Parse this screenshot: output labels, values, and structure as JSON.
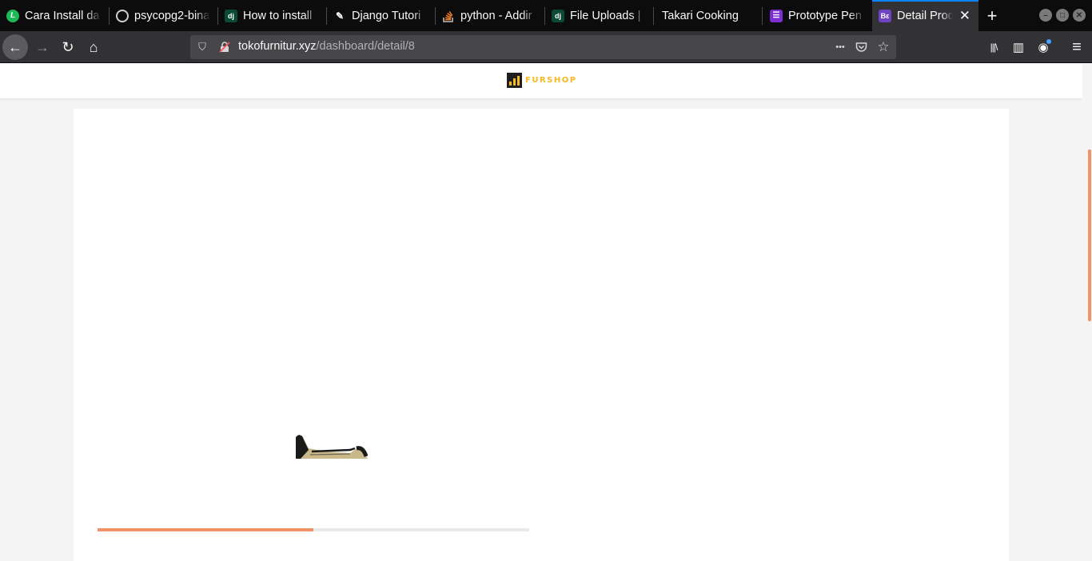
{
  "browser": {
    "tabs": [
      {
        "title": "Cara Install da",
        "favicon": "letter-l-icon",
        "active": false
      },
      {
        "title": "psycopg2-bina",
        "favicon": "github-icon",
        "active": false
      },
      {
        "title": "How to install",
        "favicon": "django-icon",
        "active": false
      },
      {
        "title": "Django Tutori",
        "favicon": "wagtail-icon",
        "active": false
      },
      {
        "title": "python - Addir",
        "favicon": "stackoverflow-icon",
        "active": false
      },
      {
        "title": "File Uploads |",
        "favicon": "django-icon",
        "active": false
      },
      {
        "title": "Takari Cooking",
        "favicon": "",
        "active": false
      },
      {
        "title": "Prototype Pen",
        "favicon": "list-icon",
        "active": false
      },
      {
        "title": "Detail Prod",
        "favicon": "bootstrap-studio-icon",
        "active": true
      }
    ],
    "favicon_glyphs": {
      "l": "L",
      "dj": "dj",
      "be": "Bε",
      "list": "☰",
      "wt": "✎"
    },
    "icons": {
      "close": "✕",
      "new_tab": "+",
      "back": "←",
      "forward": "→",
      "reload": "↻",
      "home": "⌂",
      "shield": "⛉",
      "insecure": "🔒",
      "more": "•••",
      "pocket": "◡",
      "star": "☆",
      "library": "|||\\",
      "sidebar": "▥",
      "account": "◉",
      "menu": "≡",
      "minimize": "–",
      "maximize": "□",
      "window_close": "✕"
    },
    "url": {
      "domain": "tokofurnitur.xyz",
      "path": "/dashboard/detail/8"
    }
  },
  "page": {
    "logo_text": "FURSHOP",
    "colors": {
      "accent": "#f29268",
      "logo": "#f5b921",
      "background": "#f4f4f4",
      "card": "#ffffff"
    },
    "image_load_progress": 0.5
  }
}
